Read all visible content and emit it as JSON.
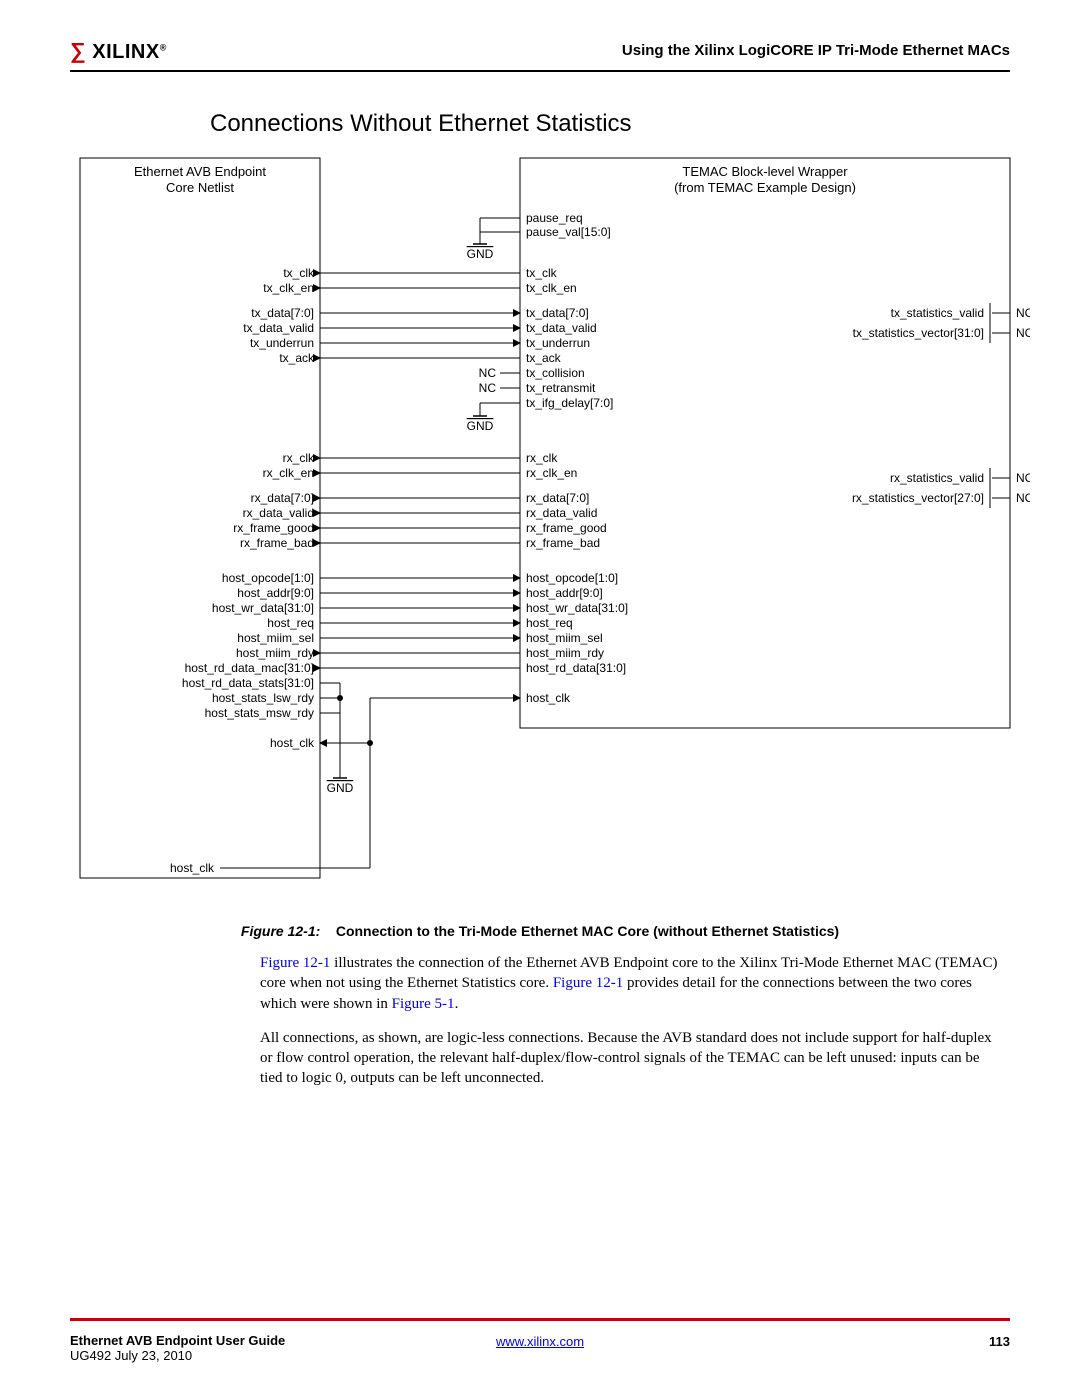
{
  "header": {
    "logo_text": "XILINX",
    "right_text": "Using the Xilinx LogiCORE IP Tri-Mode Ethernet MACs"
  },
  "section_title": "Connections Without Ethernet Statistics",
  "diagram": {
    "left_block_title1": "Ethernet AVB Endpoint",
    "left_block_title2": "Core Netlist",
    "right_block_title1": "TEMAC Block-level Wrapper",
    "right_block_title2": "(from TEMAC Example Design)",
    "gnd": "GND",
    "nc": "NC",
    "pause_req": "pause_req",
    "pause_val": "pause_val[15:0]",
    "left_signals": {
      "tx": [
        "tx_clk",
        "tx_clk_en",
        "tx_data[7:0]",
        "tx_data_valid",
        "tx_underrun",
        "tx_ack"
      ],
      "rx": [
        "rx_clk",
        "rx_clk_en",
        "rx_data[7:0]",
        "rx_data_valid",
        "rx_frame_good",
        "rx_frame_bad"
      ],
      "host": [
        "host_opcode[1:0]",
        "host_addr[9:0]",
        "host_wr_data[31:0]",
        "host_req",
        "host_miim_sel",
        "host_miim_rdy",
        "host_rd_data_mac[31:0]",
        "host_rd_data_stats[31:0]",
        "host_stats_lsw_rdy",
        "host_stats_msw_rdy"
      ],
      "host_clk_a": "host_clk",
      "host_clk_b": "host_clk"
    },
    "right_signals_left": {
      "tx": [
        "tx_clk",
        "tx_clk_en",
        "tx_data[7:0]",
        "tx_data_valid",
        "tx_underrun",
        "tx_ack",
        "tx_collision",
        "tx_retransmit",
        "tx_ifg_delay[7:0]"
      ],
      "rx": [
        "rx_clk",
        "rx_clk_en",
        "rx_data[7:0]",
        "rx_data_valid",
        "rx_frame_good",
        "rx_frame_bad"
      ],
      "host": [
        "host_opcode[1:0]",
        "host_addr[9:0]",
        "host_wr_data[31:0]",
        "host_req",
        "host_miim_sel",
        "host_miim_rdy",
        "host_rd_data[31:0]"
      ],
      "host_clk": "host_clk"
    },
    "right_signals_right": {
      "tx": [
        "tx_statistics_valid",
        "tx_statistics_vector[31:0]"
      ],
      "rx": [
        "rx_statistics_valid",
        "rx_statistics_vector[27:0]"
      ]
    }
  },
  "figure": {
    "label": "Figure 12-1:",
    "title": "Connection to the Tri-Mode Ethernet MAC Core (without Ethernet Statistics)"
  },
  "paragraphs": {
    "p1_a": "Figure 12-1",
    "p1_b": " illustrates the connection of the Ethernet AVB Endpoint core to the Xilinx Tri-Mode Ethernet MAC (TEMAC) core when not using the Ethernet Statistics core. ",
    "p1_c": "Figure 12-1",
    "p1_d": " provides detail for the connections between the two cores which were shown in ",
    "p1_e": "Figure 5-1",
    "p1_f": ".",
    "p2": "All connections, as shown, are logic-less connections. Because the AVB standard does not include support for half-duplex or flow control operation, the relevant half-duplex/flow-control signals of the TEMAC can be left unused: inputs can be tied to logic 0, outputs can be left unconnected."
  },
  "footer": {
    "guide": "Ethernet AVB Endpoint User Guide",
    "doc": "UG492 July 23, 2010",
    "url": "www.xilinx.com",
    "page": "113"
  }
}
